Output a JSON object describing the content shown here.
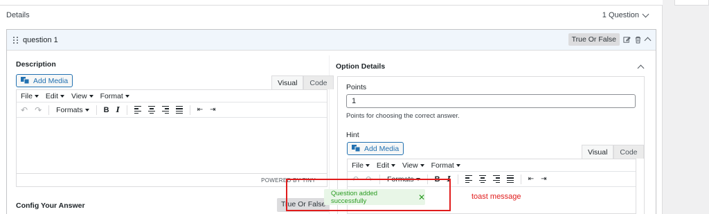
{
  "details": {
    "title": "Details",
    "question_count": "1 Question"
  },
  "question": {
    "title": "question 1",
    "type_badge": "True Or False"
  },
  "description": {
    "label": "Description",
    "add_media": "Add Media",
    "tab_visual": "Visual",
    "tab_code": "Code",
    "menu": [
      "File",
      "Edit",
      "View",
      "Format"
    ],
    "formats": "Formats",
    "bold": "B",
    "italic": "I",
    "status": "POWERED BY TINY"
  },
  "options": {
    "label": "Option Details",
    "points_label": "Points",
    "points_value": "1",
    "points_help": "Points for choosing the correct answer.",
    "hint_label": "Hint",
    "add_media": "Add Media",
    "tab_visual": "Visual",
    "tab_code": "Code",
    "menu": [
      "File",
      "Edit",
      "View",
      "Format"
    ],
    "formats": "Formats",
    "bold": "B",
    "italic": "I"
  },
  "config": {
    "label": "Config Your Answer",
    "type_button": "True Or False"
  },
  "toast": {
    "message": "Question added successfully",
    "close": "✕"
  },
  "annotation": {
    "text": "toast message",
    "color": "#e01b1b"
  }
}
